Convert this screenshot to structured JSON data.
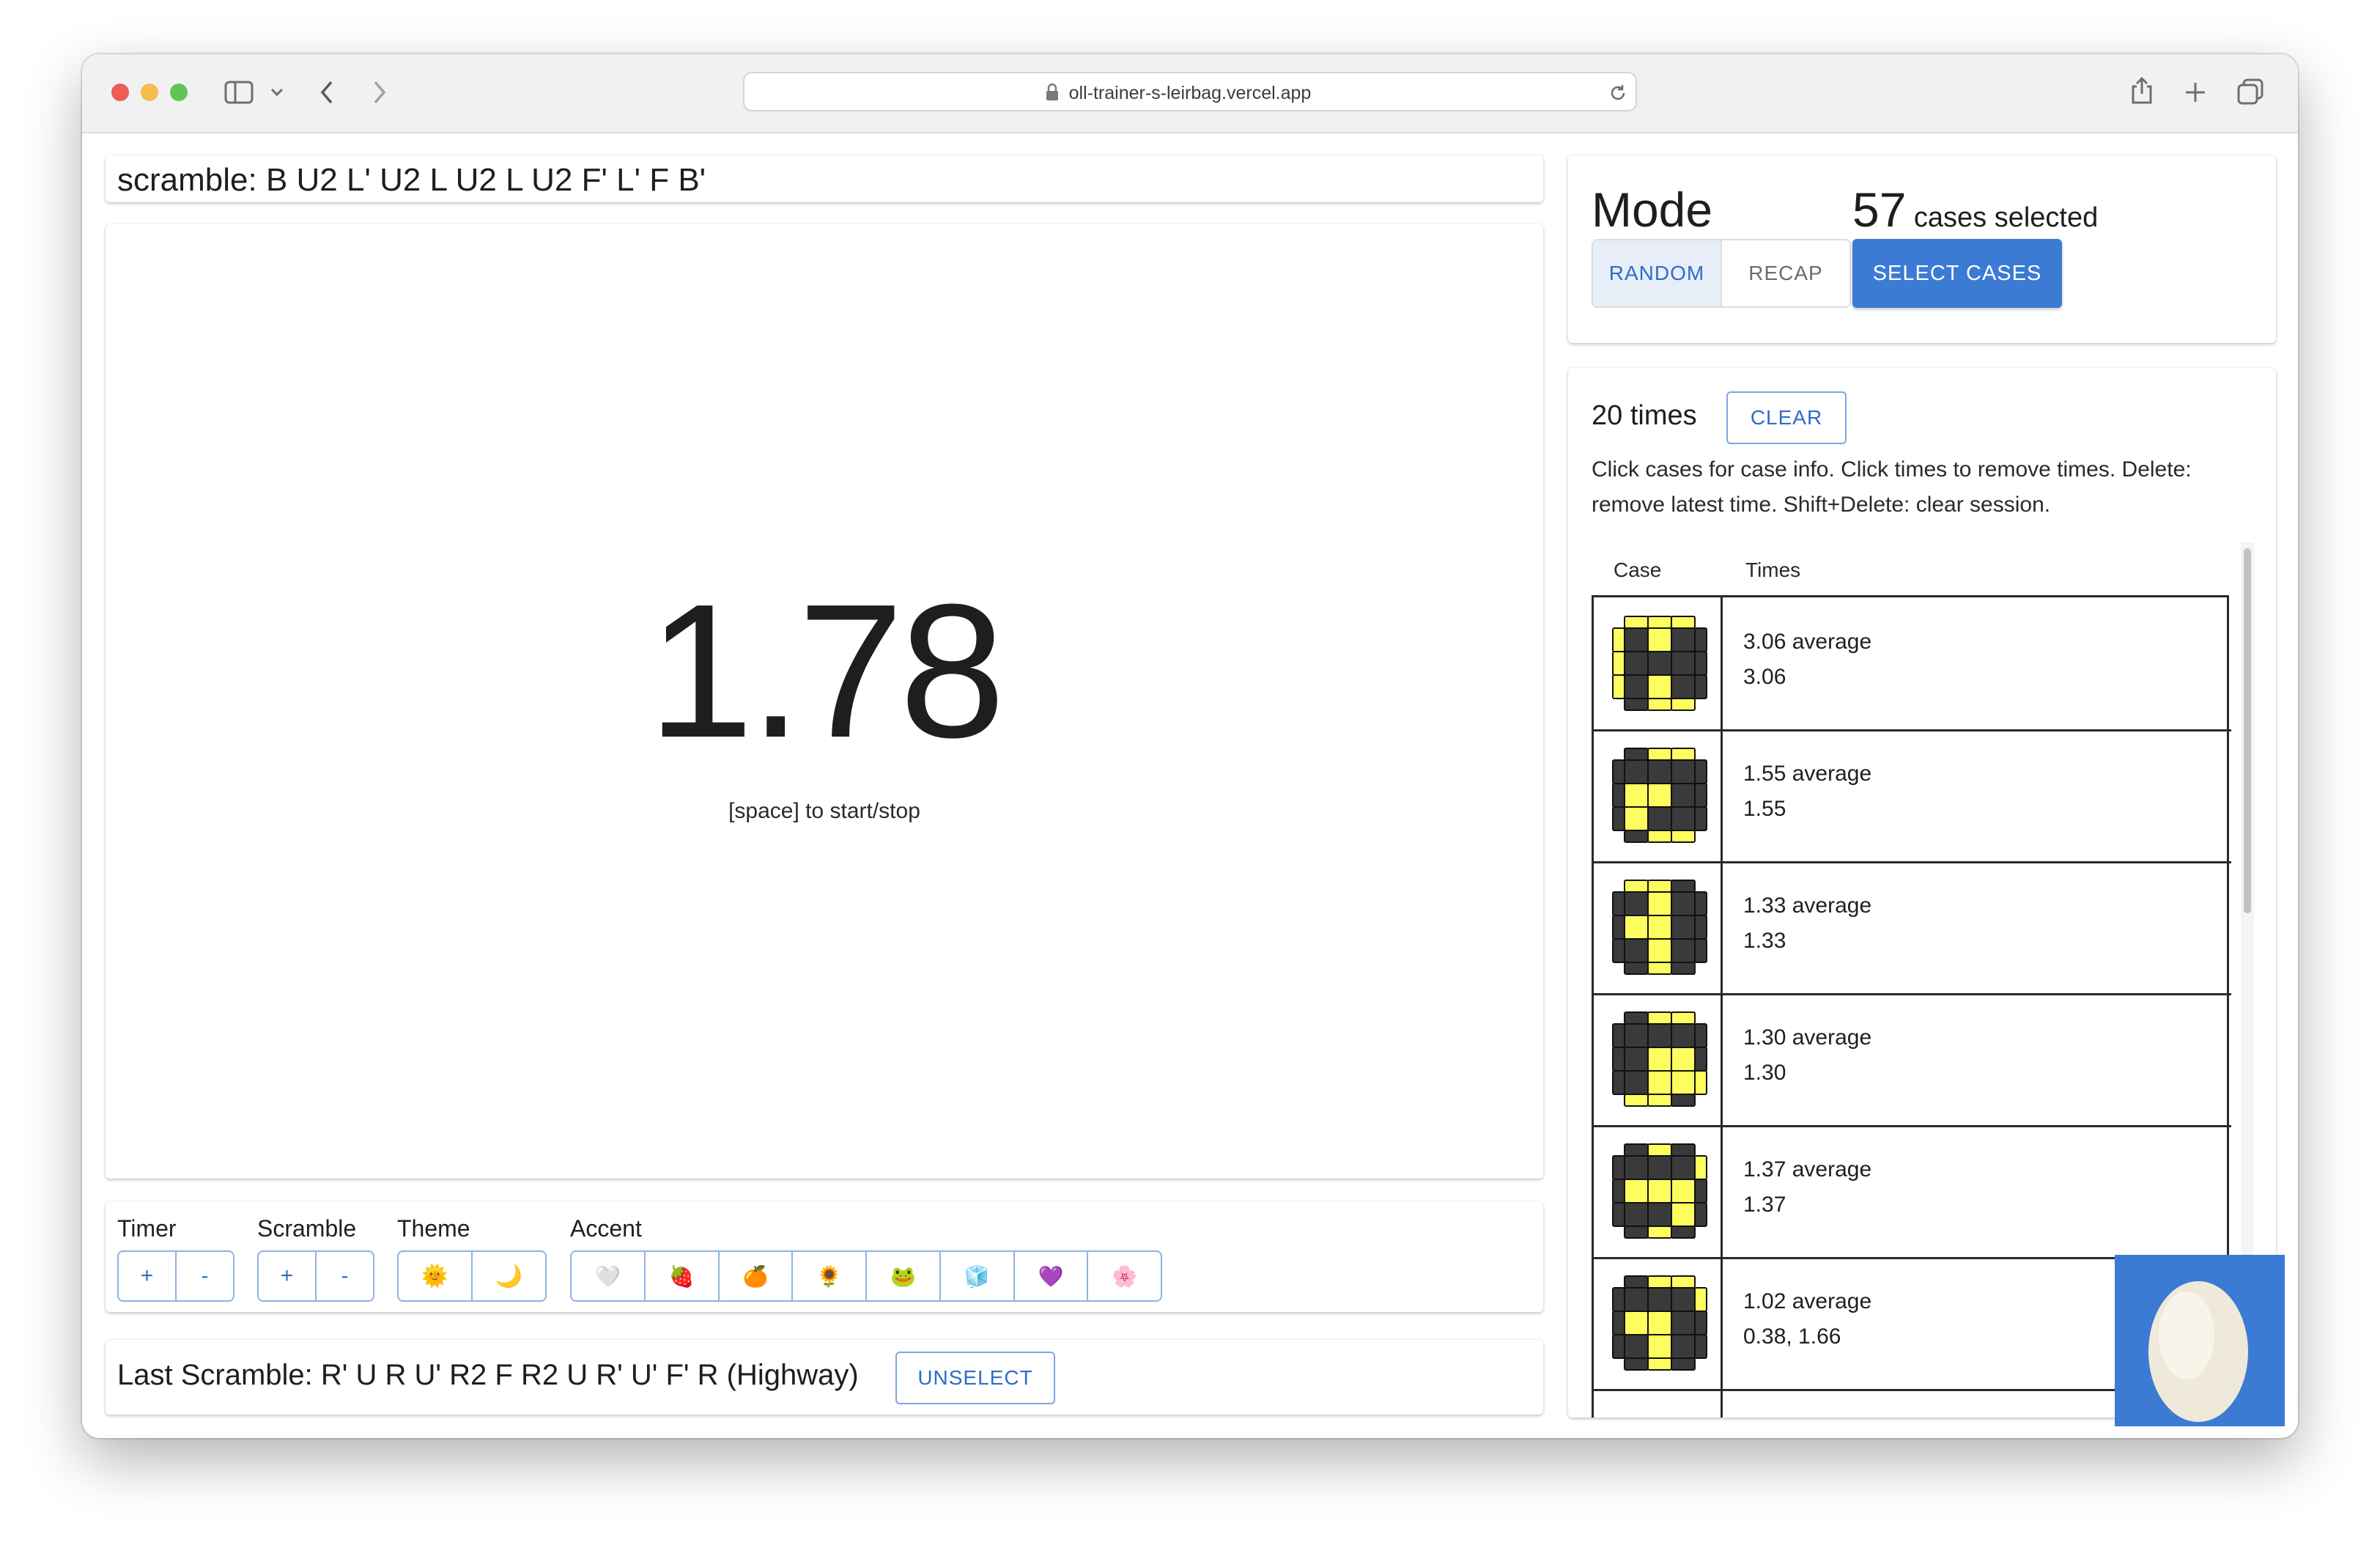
{
  "browser": {
    "url": "oll-trainer-s-leirbag.vercel.app"
  },
  "scramble": {
    "text": "scramble: B U2 L' U2 L U2 L U2 F' L' F B'"
  },
  "timer": {
    "value": "1.78",
    "hint": "[space] to start/stop"
  },
  "settings": {
    "timer_label": "Timer",
    "scramble_label": "Scramble",
    "theme_label": "Theme",
    "accent_label": "Accent",
    "plus": "+",
    "minus": "-",
    "theme_icons": [
      "🌞",
      "🌙"
    ],
    "accent_icons": [
      "🤍",
      "🍓",
      "🍊",
      "🌻",
      "🐸",
      "🧊",
      "💜",
      "🌸"
    ]
  },
  "last_scramble": {
    "text": "Last Scramble: R' U R U' R2 F R2 U R' U' F' R (Highway)",
    "unselect_label": "UNSELECT"
  },
  "mode": {
    "title": "Mode",
    "random_label": "RANDOM",
    "recap_label": "RECAP",
    "count": "57",
    "count_suffix": "cases selected",
    "select_label": "SELECT CASES"
  },
  "times": {
    "count_text": "20 times",
    "clear_label": "CLEAR",
    "help_line1": "Click cases for case info. Click times to remove times. Delete:",
    "help_line2": "remove latest time. Shift+Delete: clear session.",
    "col_case": "Case",
    "col_times": "Times",
    "rows": [
      {
        "avg": "3.06 average",
        "times": "3.06",
        "pattern": [
          0,
          1,
          0,
          0,
          0,
          0,
          0,
          1,
          0
        ],
        "edges": {
          "top": [
            1,
            1,
            1
          ],
          "bottom": [
            0,
            1,
            1
          ],
          "left": [
            1,
            1,
            1
          ],
          "right": [
            0,
            0,
            0
          ]
        }
      },
      {
        "avg": "1.55 average",
        "times": "1.55",
        "pattern": [
          0,
          0,
          0,
          1,
          1,
          0,
          1,
          0,
          0
        ],
        "edges": {
          "top": [
            0,
            1,
            1
          ],
          "bottom": [
            0,
            1,
            1
          ],
          "left": [
            0,
            0,
            0
          ],
          "right": [
            0,
            0,
            0
          ]
        }
      },
      {
        "avg": "1.33 average",
        "times": "1.33",
        "pattern": [
          0,
          1,
          0,
          1,
          1,
          0,
          0,
          1,
          0
        ],
        "edges": {
          "top": [
            1,
            1,
            0
          ],
          "bottom": [
            0,
            1,
            0
          ],
          "left": [
            0,
            0,
            0
          ],
          "right": [
            0,
            0,
            0
          ]
        }
      },
      {
        "avg": "1.30 average",
        "times": "1.30",
        "pattern": [
          0,
          0,
          0,
          0,
          1,
          1,
          0,
          1,
          1
        ],
        "edges": {
          "top": [
            0,
            1,
            1
          ],
          "bottom": [
            1,
            1,
            0
          ],
          "left": [
            0,
            0,
            0
          ],
          "right": [
            0,
            0,
            1
          ]
        }
      },
      {
        "avg": "1.37 average",
        "times": "1.37",
        "pattern": [
          0,
          0,
          0,
          1,
          1,
          1,
          0,
          0,
          1
        ],
        "edges": {
          "top": [
            0,
            1,
            0
          ],
          "bottom": [
            0,
            1,
            0
          ],
          "left": [
            0,
            0,
            0
          ],
          "right": [
            1,
            0,
            0
          ]
        }
      },
      {
        "avg": "1.02 average",
        "times": "0.38, 1.66",
        "pattern": [
          0,
          0,
          0,
          1,
          1,
          0,
          0,
          1,
          0
        ],
        "edges": {
          "top": [
            0,
            1,
            1
          ],
          "bottom": [
            0,
            1,
            0
          ],
          "left": [
            0,
            0,
            0
          ],
          "right": [
            1,
            0,
            0
          ]
        }
      }
    ]
  },
  "colors": {
    "accent": "#3b7bd4",
    "sticker_yellow": "#fdfd5f",
    "sticker_dark": "#3a3a3a"
  }
}
